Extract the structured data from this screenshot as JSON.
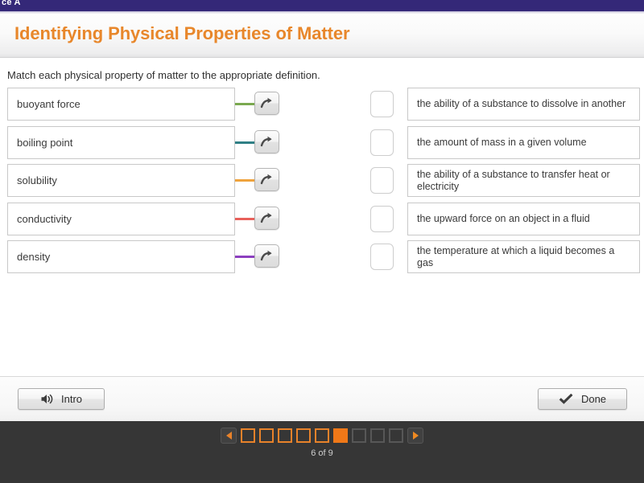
{
  "topbar": {
    "label": "ce A",
    "bg": "#342878"
  },
  "header": {
    "title": "Identifying Physical Properties of Matter",
    "title_color": "#e8872b"
  },
  "main": {
    "instruction": "Match each physical property of matter to the appropriate definition.",
    "terms": [
      {
        "label": "buoyant force",
        "connector_color": "#7aa94f",
        "arrow_icon": "curved-arrow-right-icon"
      },
      {
        "label": "boiling point",
        "connector_color": "#2f7f85",
        "arrow_icon": "curved-arrow-right-icon"
      },
      {
        "label": "solubility",
        "connector_color": "#efa33c",
        "arrow_icon": "curved-arrow-right-icon"
      },
      {
        "label": "conductivity",
        "connector_color": "#e8605a",
        "arrow_icon": "curved-arrow-right-icon"
      },
      {
        "label": "density",
        "connector_color": "#8c3fbf",
        "arrow_icon": "curved-arrow-right-icon"
      }
    ],
    "definitions": [
      {
        "text": "the ability of a substance to dissolve in another",
        "drop_value": ""
      },
      {
        "text": "the amount of mass in a given volume",
        "drop_value": ""
      },
      {
        "text": "the ability of a substance to transfer heat or electricity",
        "drop_value": ""
      },
      {
        "text": "the upward force on an object in a fluid",
        "drop_value": ""
      },
      {
        "text": "the temperature at which a liquid becomes a gas",
        "drop_value": ""
      }
    ]
  },
  "controls": {
    "intro_label": "Intro",
    "intro_icon": "speaker-icon",
    "done_label": "Done",
    "done_icon": "checkmark-icon"
  },
  "footer": {
    "prev_icon": "triangle-left-icon",
    "next_icon": "triangle-right-icon",
    "page_count_label": "6 of 9",
    "current_page": 6,
    "total_pages": 9,
    "accent": "#f07818",
    "pages": [
      {
        "state": "visited"
      },
      {
        "state": "visited"
      },
      {
        "state": "visited"
      },
      {
        "state": "visited"
      },
      {
        "state": "visited"
      },
      {
        "state": "current"
      },
      {
        "state": "unvisited"
      },
      {
        "state": "unvisited"
      },
      {
        "state": "unvisited"
      }
    ]
  }
}
